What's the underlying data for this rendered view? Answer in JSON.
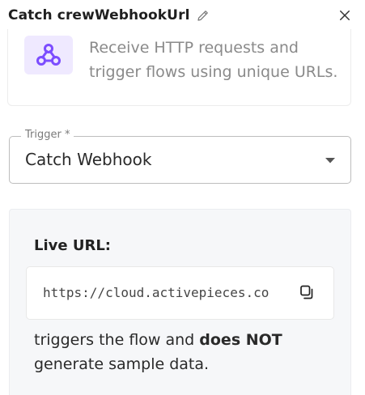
{
  "header": {
    "title": "Catch crewWebhookUrl",
    "edit_icon": "pencil-icon",
    "close_icon": "close-icon"
  },
  "description": {
    "icon": "webhook-icon",
    "text_line1": "Receive HTTP requests and",
    "text_line2": "trigger flows using unique URLs."
  },
  "trigger": {
    "label": "Trigger *",
    "value": "Catch Webhook",
    "caret_icon": "caret-down-icon"
  },
  "panel": {
    "live_url_label": "Live URL:",
    "url": "https://cloud.activepieces.co",
    "copy_icon": "copy-icon",
    "note_before": "triggers the flow and ",
    "note_bold": "does NOT",
    "note_after": "generate sample data."
  },
  "colors": {
    "accent": "#7c4dff",
    "icon_bg": "#efe9ff",
    "panel_bg": "#f6f7f9"
  }
}
